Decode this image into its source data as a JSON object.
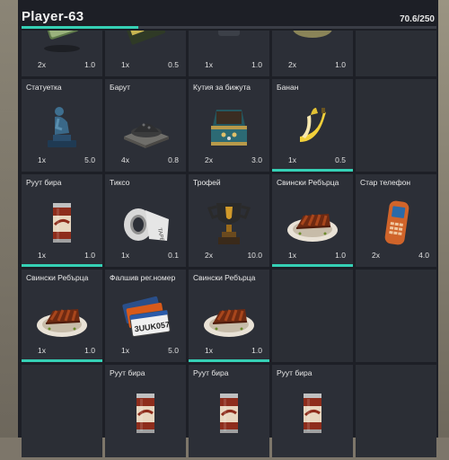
{
  "header": {
    "player_name": "Player-63",
    "weight_label": "70.6/250",
    "weight_fraction": 0.282
  },
  "rows": [
    [
      {
        "name": "",
        "count": "2x",
        "weight": "1.0",
        "icon": "cash-bundle-icon",
        "durability": false
      },
      {
        "name": "",
        "count": "1x",
        "weight": "0.5",
        "icon": "card-icon",
        "durability": false
      },
      {
        "name": "",
        "count": "1x",
        "weight": "1.0",
        "icon": "unknown-item-icon",
        "durability": false
      },
      {
        "name": "",
        "count": "2x",
        "weight": "1.0",
        "icon": "powder-pile-icon",
        "durability": false
      },
      {
        "empty": true
      }
    ],
    [
      {
        "name": "Статуетка",
        "count": "1x",
        "weight": "5.0",
        "icon": "thinker-statue-icon",
        "durability": false
      },
      {
        "name": "Барут",
        "count": "4x",
        "weight": "0.8",
        "icon": "gunpowder-icon",
        "durability": false
      },
      {
        "name": "Кутия за бижута",
        "count": "2x",
        "weight": "3.0",
        "icon": "jewelry-box-icon",
        "durability": false
      },
      {
        "name": "Банан",
        "count": "1x",
        "weight": "0.5",
        "icon": "banana-icon",
        "durability": true
      },
      {
        "empty": true
      }
    ],
    [
      {
        "name": "Руут бира",
        "count": "1x",
        "weight": "1.0",
        "icon": "root-beer-can-icon",
        "durability": true
      },
      {
        "name": "Тиксо",
        "count": "1x",
        "weight": "0.1",
        "icon": "duct-tape-icon",
        "durability": false
      },
      {
        "name": "Трофей",
        "count": "2x",
        "weight": "10.0",
        "icon": "trophy-icon",
        "durability": false
      },
      {
        "name": "Свински Ребърца",
        "count": "1x",
        "weight": "1.0",
        "icon": "pork-ribs-icon",
        "durability": true
      },
      {
        "name": "Стар телефон",
        "count": "2x",
        "weight": "4.0",
        "icon": "old-phone-icon",
        "durability": false
      }
    ],
    [
      {
        "name": "Свински Ребърца",
        "count": "1x",
        "weight": "1.0",
        "icon": "pork-ribs-icon",
        "durability": true
      },
      {
        "name": "Фалшив рег.номер",
        "count": "1x",
        "weight": "5.0",
        "icon": "license-plate-icon",
        "durability": false,
        "plate_text": "3UUK057"
      },
      {
        "name": "Свински Ребърца",
        "count": "1x",
        "weight": "1.0",
        "icon": "pork-ribs-icon",
        "durability": true
      },
      {
        "empty": true
      },
      {
        "empty": true
      }
    ],
    [
      {
        "empty": true
      },
      {
        "name": "Руут бира",
        "count": "",
        "weight": "",
        "icon": "root-beer-can-icon",
        "durability": false
      },
      {
        "name": "Руут бира",
        "count": "",
        "weight": "",
        "icon": "root-beer-can-icon",
        "durability": false
      },
      {
        "name": "Руут бира",
        "count": "",
        "weight": "",
        "icon": "root-beer-can-icon",
        "durability": false
      },
      {
        "empty": true
      }
    ]
  ]
}
